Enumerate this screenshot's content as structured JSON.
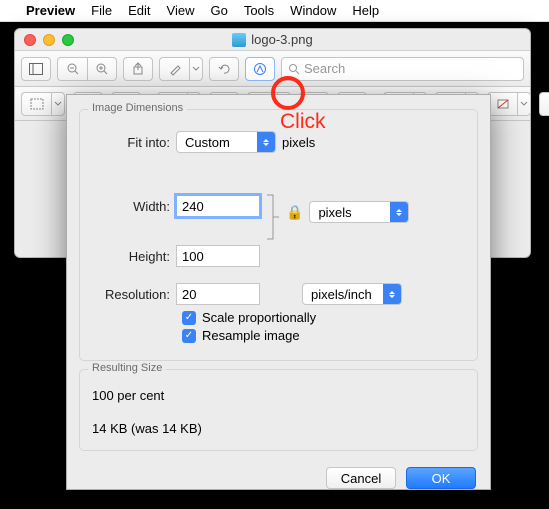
{
  "menubar": {
    "app": "Preview",
    "items": [
      "File",
      "Edit",
      "View",
      "Go",
      "Tools",
      "Window",
      "Help"
    ]
  },
  "window": {
    "title": "logo-3.png",
    "search_placeholder": "Search"
  },
  "annotation": {
    "label": "Click"
  },
  "dialog": {
    "group1": "Image Dimensions",
    "fit_into_label": "Fit into:",
    "fit_into_value": "Custom",
    "fit_into_unit": "pixels",
    "width_label": "Width:",
    "width_value": "240",
    "height_label": "Height:",
    "height_value": "100",
    "wh_unit": "pixels",
    "res_label": "Resolution:",
    "res_value": "20",
    "res_unit": "pixels/inch",
    "scale_label": "Scale proportionally",
    "resample_label": "Resample image",
    "group2": "Resulting Size",
    "percent": "100 per cent",
    "size": "14 KB (was 14 KB)",
    "cancel": "Cancel",
    "ok": "OK"
  }
}
